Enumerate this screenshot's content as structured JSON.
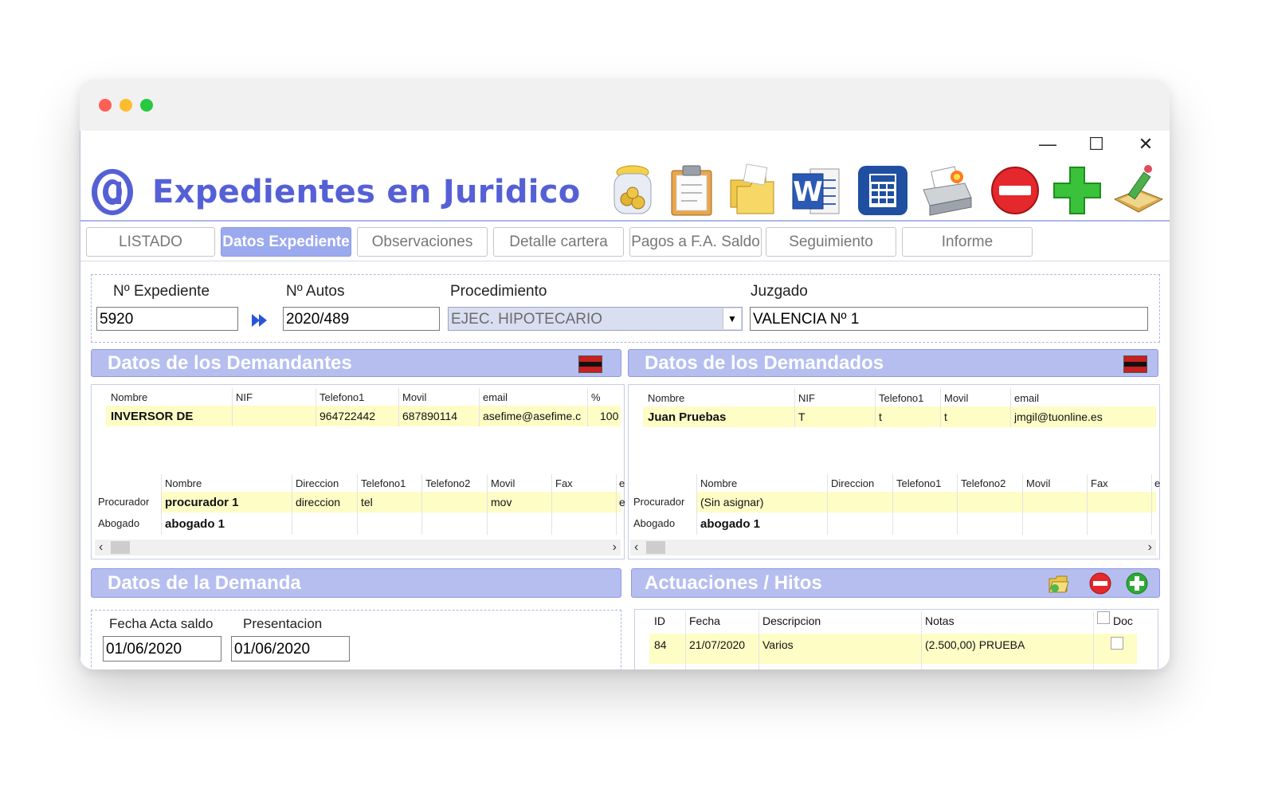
{
  "app": {
    "title": "Expedientes en Juridico",
    "window_controls": {
      "minimize": "—",
      "maximize": "☐",
      "close": "✕"
    }
  },
  "toolbar": {
    "icons": [
      "coins-jar-icon",
      "clipboard-icon",
      "folders-icon",
      "word-icon",
      "calculator-icon",
      "printer-icon",
      "delete-icon",
      "add-icon",
      "edit-icon"
    ]
  },
  "tabs": [
    "LISTADO",
    "Datos Expediente",
    "Observaciones",
    "Detalle cartera",
    "Pagos a F.A. Saldo",
    "Seguimiento",
    "Informe"
  ],
  "active_tab": "Datos Expediente",
  "case": {
    "expediente_label": "Nº Expediente",
    "expediente_value": "5920",
    "autos_label": "Nº Autos",
    "autos_value": "2020/489",
    "procedimiento_label": "Procedimiento",
    "procedimiento_value": "EJEC. HIPOTECARIO",
    "juzgado_label": "Juzgado",
    "juzgado_value": "VALENCIA Nº 1"
  },
  "demandantes": {
    "title": "Datos de los Demandantes",
    "headers": [
      "Nombre",
      "NIF",
      "Telefono1",
      "Movil",
      "email",
      "%"
    ],
    "rows": [
      [
        "INVERSOR DE",
        "",
        "964722442",
        "687890114",
        "asefime@asefime.c",
        "100"
      ]
    ],
    "legal_headers": [
      "Nombre",
      "Direccion",
      "Telefono1",
      "Telefono2",
      "Movil",
      "Fax",
      "e"
    ],
    "legal_rows": [
      {
        "role": "Procurador",
        "cells": [
          "procurador 1",
          "direccion",
          "tel",
          "",
          "mov",
          "",
          "e"
        ]
      },
      {
        "role": "Abogado",
        "cells": [
          "abogado 1",
          "",
          "",
          "",
          "",
          "",
          ""
        ]
      }
    ]
  },
  "demandados": {
    "title": "Datos de los Demandados",
    "headers": [
      "Nombre",
      "NIF",
      "Telefono1",
      "Movil",
      "email"
    ],
    "rows": [
      [
        "Juan Pruebas",
        "T",
        "t",
        "t",
        "jmgil@tuonline.es"
      ]
    ],
    "legal_headers": [
      "Nombre",
      "Direccion",
      "Telefono1",
      "Telefono2",
      "Movil",
      "Fax",
      "e"
    ],
    "legal_rows": [
      {
        "role": "Procurador",
        "cells": [
          "(Sin asignar)",
          "",
          "",
          "",
          "",
          "",
          ""
        ]
      },
      {
        "role": "Abogado",
        "cells": [
          "abogado 1",
          "",
          "",
          "",
          "",
          "",
          ""
        ]
      }
    ]
  },
  "demanda": {
    "title": "Datos de la Demanda",
    "fecha_label": "Fecha Acta saldo",
    "fecha_value": "01/06/2020",
    "presentacion_label": "Presentacion",
    "presentacion_value": "01/06/2020"
  },
  "actuaciones": {
    "title": "Actuaciones / Hitos",
    "headers": [
      "ID",
      "Fecha",
      "Descripcion",
      "Notas",
      "Doc"
    ],
    "rows": [
      [
        "84",
        "21/07/2020",
        "Varios",
        "(2.500,00) PRUEBA",
        ""
      ]
    ]
  },
  "scroll_arrows": {
    "left": "‹",
    "right": "›"
  },
  "colors": {
    "accent": "#5560d6",
    "section_header": "#b5beef",
    "row_highlight": "#fefdc6",
    "active_tab": "#9ba9ee"
  }
}
